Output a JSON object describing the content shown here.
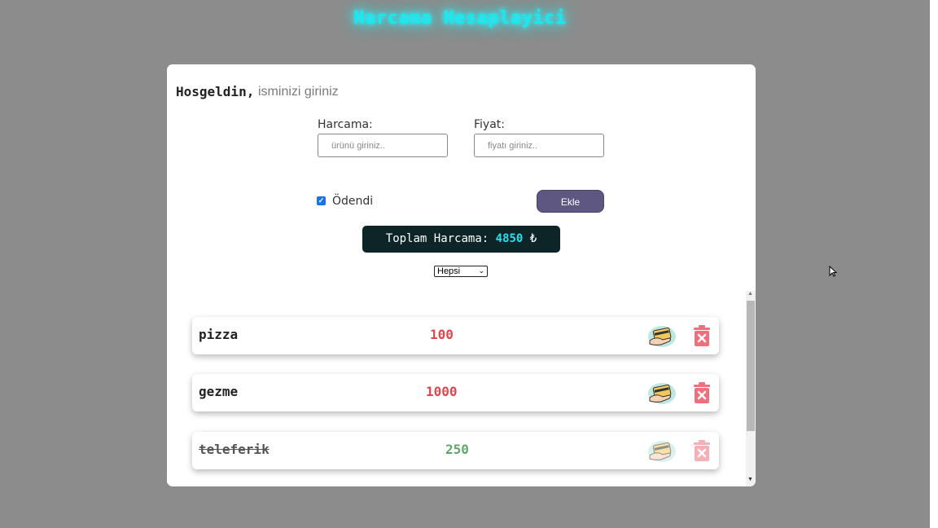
{
  "header": {
    "title": "Harcama Hesaplayici"
  },
  "welcome": {
    "greeting": "Hosgeldin,",
    "name_placeholder": "isminizi giriniz"
  },
  "form": {
    "expense_label": "Harcama:",
    "expense_placeholder": "ürünü giriniz..",
    "price_label": "Fiyat:",
    "price_placeholder": "fiyatı giriniz..",
    "paid_label": "Ödendi",
    "paid_checked": true,
    "add_button": "Ekle"
  },
  "total": {
    "label": "Toplam Harcama:",
    "value": "4850",
    "currency": "₺"
  },
  "filter": {
    "selected": "Hepsi"
  },
  "expenses": [
    {
      "name": "pizza",
      "price": "100",
      "paid": false
    },
    {
      "name": "gezme",
      "price": "1000",
      "paid": false
    },
    {
      "name": "teleferik",
      "price": "250",
      "paid": true
    }
  ],
  "colors": {
    "title_glow": "#18e8f0",
    "background": "#8c8c8c",
    "button": "#5d5782",
    "total_bg": "#0d2526",
    "unpaid_price": "#e0474c",
    "paid_price": "#5fa86b",
    "trash": "#ef6f7d"
  },
  "icons": {
    "pay": "credit-card-hand-icon",
    "delete": "trash-x-icon"
  }
}
